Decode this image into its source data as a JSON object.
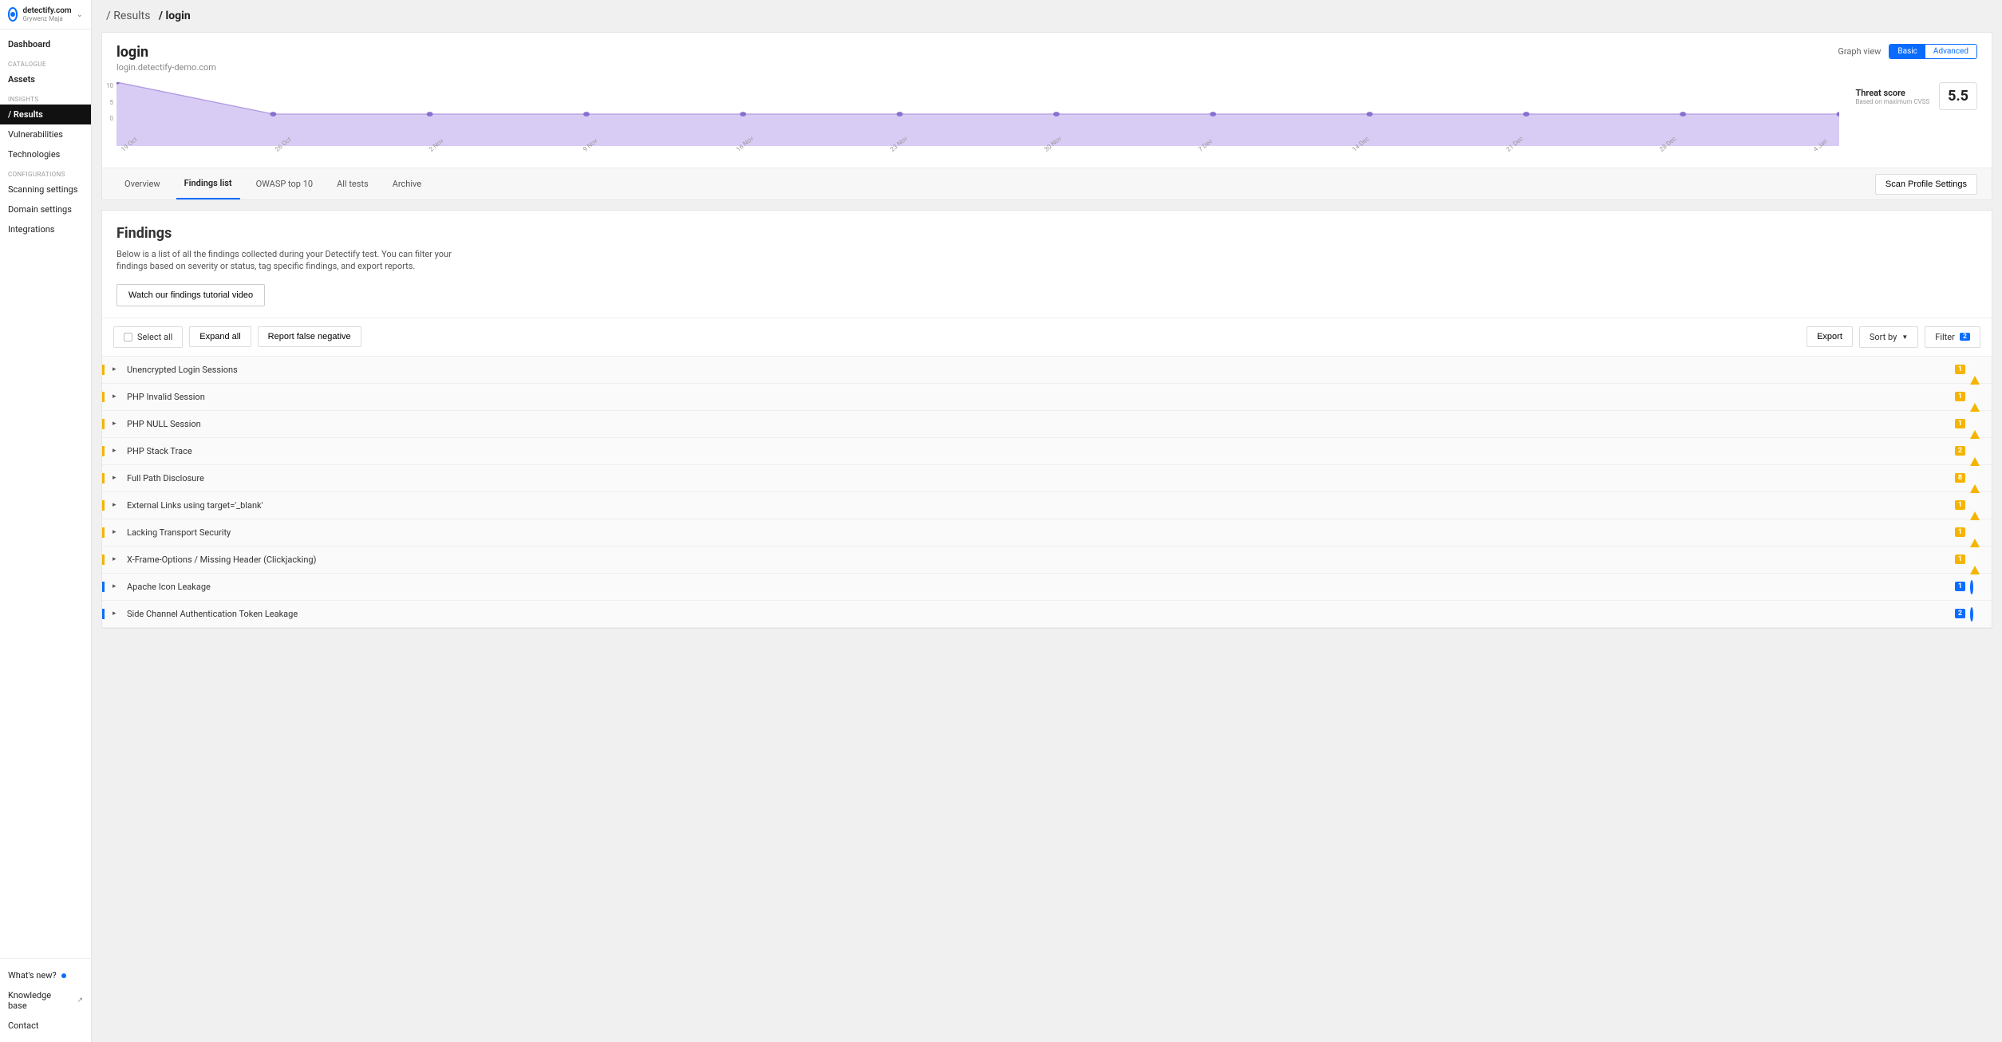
{
  "sidebar": {
    "domain": "detectify.com",
    "user": "Grywenz Maja",
    "items": {
      "dashboard": "Dashboard",
      "catalogue_label": "CATALOGUE",
      "assets": "Assets",
      "insights_label": "INSIGHTS",
      "results": "/ Results",
      "vulnerabilities": "Vulnerabilities",
      "technologies": "Technologies",
      "config_label": "CONFIGURATIONS",
      "scanning": "Scanning settings",
      "domain_settings": "Domain settings",
      "integrations": "Integrations"
    },
    "footer": {
      "whats_new": "What's new?",
      "knowledge": "Knowledge base",
      "contact": "Contact"
    }
  },
  "breadcrumb": {
    "c1": "/ Results",
    "c2": "/ login"
  },
  "header": {
    "title": "login",
    "subtitle": "login.detectify-demo.com",
    "graph_view": "Graph view",
    "basic": "Basic",
    "advanced": "Advanced"
  },
  "chart_data": {
    "type": "area",
    "title": "",
    "xlabel": "",
    "ylabel": "",
    "ylim": [
      0,
      10
    ],
    "y_ticks": [
      "10",
      "5",
      "0"
    ],
    "categories": [
      "19 Oct",
      "26 Oct",
      "2 Nov",
      "9 Nov",
      "16 Nov",
      "23 Nov",
      "30 Nov",
      "7 Dec",
      "14 Dec",
      "21 Dec",
      "28 Dec",
      "4 Jan"
    ],
    "values": [
      10,
      5,
      5,
      5,
      5,
      5,
      5,
      5,
      5,
      5,
      5,
      5
    ]
  },
  "threat": {
    "label": "Threat score",
    "sub": "Based on maximum CVSS",
    "value": "5.5"
  },
  "tabs": {
    "overview": "Overview",
    "findings": "Findings list",
    "owasp": "OWASP top 10",
    "all_tests": "All tests",
    "archive": "Archive",
    "scan_settings": "Scan Profile Settings"
  },
  "findings_section": {
    "title": "Findings",
    "desc": "Below is a list of all the findings collected during your Detectify test. You can filter your findings based on severity or status, tag specific findings, and export reports.",
    "tutorial": "Watch our findings tutorial video"
  },
  "toolbar": {
    "select_all": "Select all",
    "expand_all": "Expand all",
    "report_fn": "Report false negative",
    "export": "Export",
    "sort_by": "Sort by",
    "filter": "Filter",
    "filter_count": "2"
  },
  "findings": [
    {
      "name": "Unencrypted Login Sessions",
      "count": "1",
      "sev": "medium"
    },
    {
      "name": "PHP Invalid Session",
      "count": "1",
      "sev": "medium"
    },
    {
      "name": "PHP NULL Session",
      "count": "1",
      "sev": "medium"
    },
    {
      "name": "PHP Stack Trace",
      "count": "2",
      "sev": "medium"
    },
    {
      "name": "Full Path Disclosure",
      "count": "8",
      "sev": "medium"
    },
    {
      "name": "External Links using target='_blank'",
      "count": "1",
      "sev": "medium"
    },
    {
      "name": "Lacking Transport Security",
      "count": "1",
      "sev": "medium"
    },
    {
      "name": "X-Frame-Options / Missing Header (Clickjacking)",
      "count": "1",
      "sev": "medium"
    },
    {
      "name": "Apache Icon Leakage",
      "count": "1",
      "sev": "info"
    },
    {
      "name": "Side Channel Authentication Token Leakage",
      "count": "2",
      "sev": "info"
    }
  ]
}
